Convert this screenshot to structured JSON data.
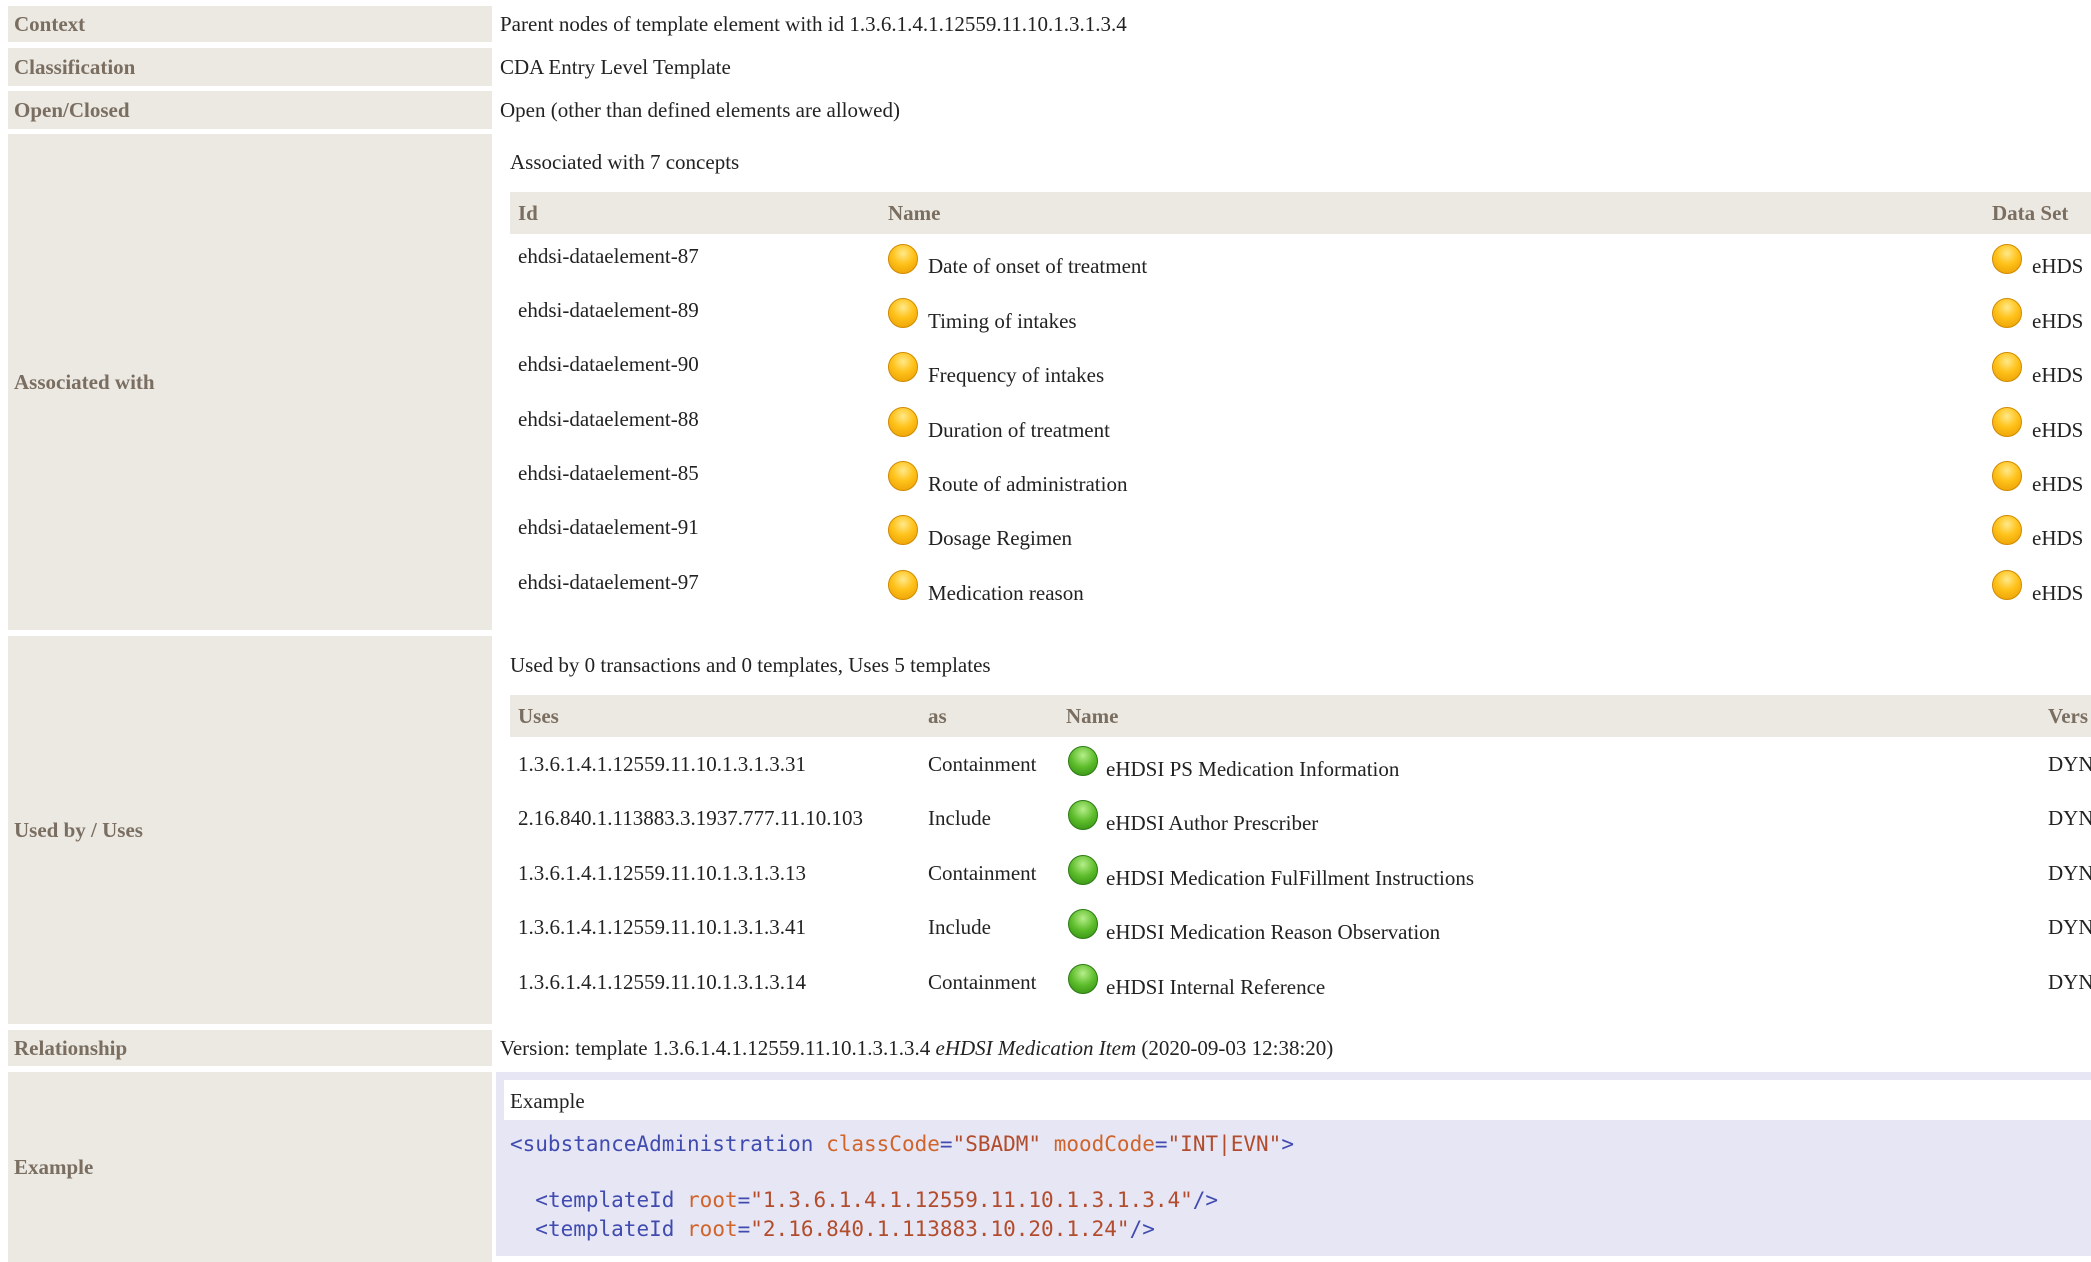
{
  "rows": {
    "context": {
      "label": "Context",
      "value": "Parent nodes of template element with id 1.3.6.1.4.1.12559.11.10.1.3.1.3.4"
    },
    "classification": {
      "label": "Classification",
      "value": "CDA Entry Level Template"
    },
    "open_closed": {
      "label": "Open/Closed",
      "value": "Open (other than defined elements are allowed)"
    },
    "associated": {
      "label": "Associated with",
      "summary": "Associated with 7 concepts",
      "columns": [
        "Id",
        "Name",
        "Data Set"
      ],
      "items": [
        {
          "id": "ehdsi-dataelement-87",
          "name": "Date of onset of treatment",
          "dataset": "eHDS"
        },
        {
          "id": "ehdsi-dataelement-89",
          "name": "Timing of intakes",
          "dataset": "eHDS"
        },
        {
          "id": "ehdsi-dataelement-90",
          "name": "Frequency of intakes",
          "dataset": "eHDS"
        },
        {
          "id": "ehdsi-dataelement-88",
          "name": "Duration of treatment",
          "dataset": "eHDS"
        },
        {
          "id": "ehdsi-dataelement-85",
          "name": "Route of administration",
          "dataset": "eHDS"
        },
        {
          "id": "ehdsi-dataelement-91",
          "name": "Dosage Regimen",
          "dataset": "eHDS"
        },
        {
          "id": "ehdsi-dataelement-97",
          "name": "Medication reason",
          "dataset": "eHDS"
        }
      ]
    },
    "used_by": {
      "label": "Used by / Uses",
      "summary": "Used by 0 transactions and 0 templates, Uses 5 templates",
      "columns": [
        "Uses",
        "as",
        "Name",
        "Vers"
      ],
      "items": [
        {
          "uses": "1.3.6.1.4.1.12559.11.10.1.3.1.3.31",
          "as": "Containment",
          "name": "eHDSI PS Medication Information",
          "version": "DYN"
        },
        {
          "uses": "2.16.840.1.113883.3.1937.777.11.10.103",
          "as": "Include",
          "name": "eHDSI Author Prescriber",
          "version": "DYN"
        },
        {
          "uses": "1.3.6.1.4.1.12559.11.10.1.3.1.3.13",
          "as": "Containment",
          "name": "eHDSI Medication FulFillment Instructions",
          "version": "DYN"
        },
        {
          "uses": "1.3.6.1.4.1.12559.11.10.1.3.1.3.41",
          "as": "Include",
          "name": "eHDSI Medication Reason Observation",
          "version": "DYN"
        },
        {
          "uses": "1.3.6.1.4.1.12559.11.10.1.3.1.3.14",
          "as": "Containment",
          "name": "eHDSI Internal Reference",
          "version": "DYN"
        }
      ]
    },
    "relationship": {
      "label": "Relationship",
      "prefix": "Version: template 1.3.6.1.4.1.12559.11.10.1.3.1.3.4 ",
      "name": "eHDSI Medication Item",
      "suffix": " (2020-09-03 12:38:20)"
    },
    "example": {
      "label": "Example",
      "title": "Example",
      "line1": {
        "tag_open": "<substanceAdministration",
        "attr1": "classCode",
        "val1": "\"SBADM\"",
        "attr2": "moodCode",
        "val2": "\"INT|EVN\"",
        "close": ">"
      },
      "line2": {
        "tag_open": "<templateId",
        "attr": "root",
        "val": "\"1.3.6.1.4.1.12559.11.10.1.3.1.3.4\"",
        "close": "/>"
      },
      "line3": {
        "tag_open": "<templateId",
        "attr": "root",
        "val": "\"2.16.840.1.113883.10.20.1.24\"",
        "close": "/>"
      }
    }
  },
  "colors": {
    "label_bg": "#ece9e3",
    "label_text": "#7a6e61",
    "example_bg": "#e6e6f4",
    "concept_dot": "#ffc21a",
    "template_dot": "#5cbc2a"
  }
}
